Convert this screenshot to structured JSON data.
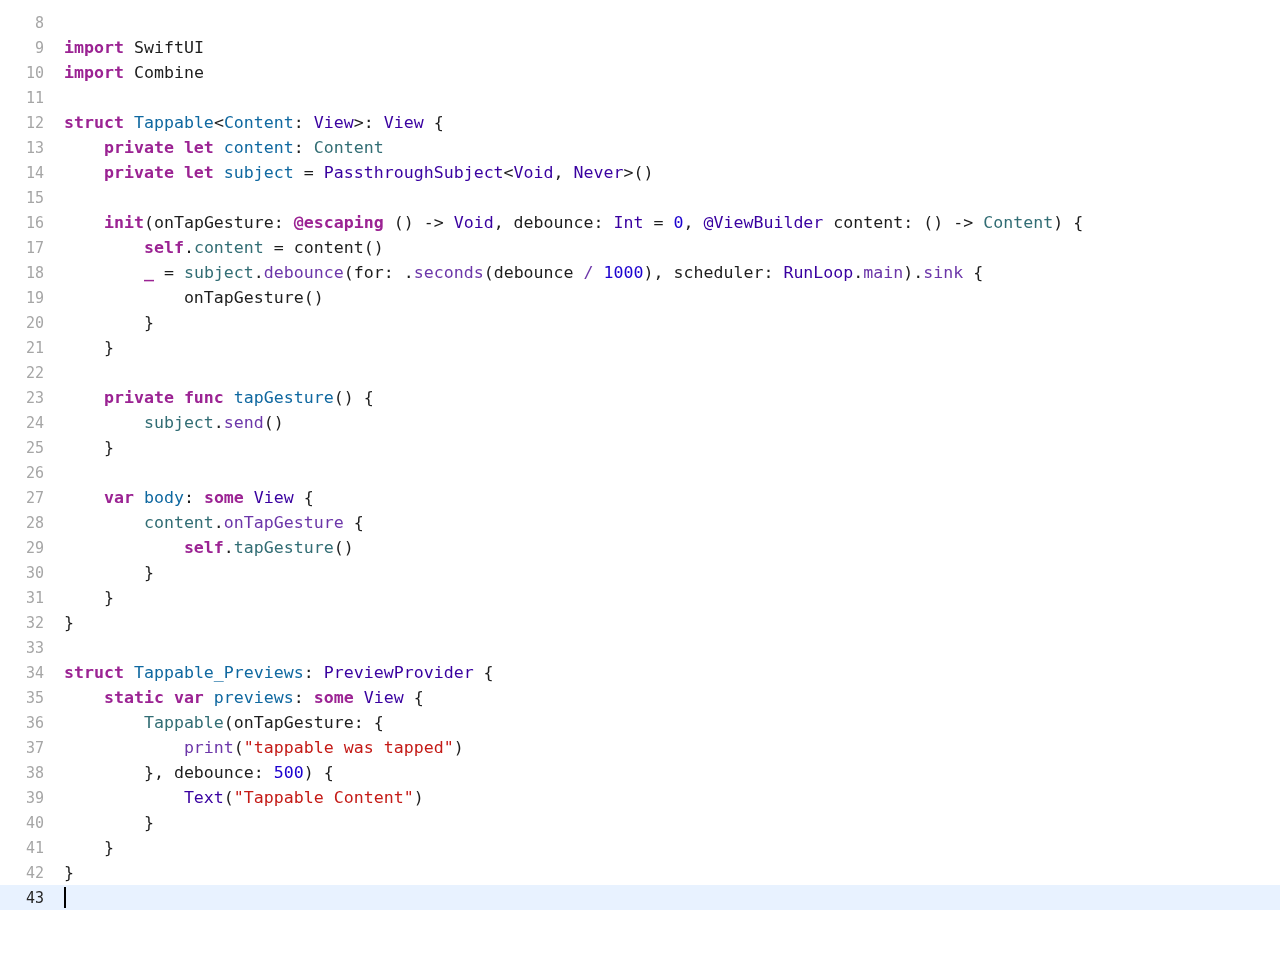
{
  "editor": {
    "lines": [
      {
        "number": "8",
        "current": false
      },
      {
        "number": "9",
        "current": false,
        "tokens": [
          {
            "kind": "keyword",
            "text": "import "
          },
          {
            "kind": "plain",
            "text": "SwiftUI"
          }
        ]
      },
      {
        "number": "10",
        "current": false,
        "tokens": [
          {
            "kind": "keyword",
            "text": "import "
          },
          {
            "kind": "plain",
            "text": "Combine"
          }
        ]
      },
      {
        "number": "11",
        "current": false
      },
      {
        "number": "12",
        "current": false,
        "tokens": [
          {
            "kind": "keyword",
            "text": "struct "
          },
          {
            "kind": "declaration",
            "text": "Tappable"
          },
          {
            "kind": "plain",
            "text": "<"
          },
          {
            "kind": "declaration",
            "text": "Content"
          },
          {
            "kind": "plain",
            "text": ": "
          },
          {
            "kind": "system_type",
            "text": "View"
          },
          {
            "kind": "plain",
            "text": ">: "
          },
          {
            "kind": "system_type",
            "text": "View"
          },
          {
            "kind": "plain",
            "text": " {"
          }
        ]
      },
      {
        "number": "13",
        "current": false,
        "tokens": [
          {
            "kind": "keyword",
            "text": "    private let "
          },
          {
            "kind": "declaration",
            "text": "content"
          },
          {
            "kind": "plain",
            "text": ": "
          },
          {
            "kind": "project",
            "text": "Content"
          }
        ]
      },
      {
        "number": "14",
        "current": false,
        "tokens": [
          {
            "kind": "keyword",
            "text": "    private let "
          },
          {
            "kind": "declaration",
            "text": "subject"
          },
          {
            "kind": "plain",
            "text": " = "
          },
          {
            "kind": "system_type",
            "text": "PassthroughSubject"
          },
          {
            "kind": "plain",
            "text": "<"
          },
          {
            "kind": "system_type",
            "text": "Void"
          },
          {
            "kind": "plain",
            "text": ", "
          },
          {
            "kind": "system_type",
            "text": "Never"
          },
          {
            "kind": "plain",
            "text": ">()"
          }
        ]
      },
      {
        "number": "15",
        "current": false
      },
      {
        "number": "16",
        "current": false,
        "tokens": [
          {
            "kind": "keyword",
            "text": "    init"
          },
          {
            "kind": "plain",
            "text": "(onTapGesture: "
          },
          {
            "kind": "keyword",
            "text": "@escaping"
          },
          {
            "kind": "plain",
            "text": " () -> "
          },
          {
            "kind": "system_type",
            "text": "Void"
          },
          {
            "kind": "plain",
            "text": ", debounce: "
          },
          {
            "kind": "system_type",
            "text": "Int"
          },
          {
            "kind": "plain",
            "text": " = "
          },
          {
            "kind": "number",
            "text": "0"
          },
          {
            "kind": "plain",
            "text": ", "
          },
          {
            "kind": "system_type",
            "text": "@ViewBuilder"
          },
          {
            "kind": "plain",
            "text": " content: () -> "
          },
          {
            "kind": "project",
            "text": "Content"
          },
          {
            "kind": "plain",
            "text": ") {"
          }
        ]
      },
      {
        "number": "17",
        "current": false,
        "tokens": [
          {
            "kind": "keyword",
            "text": "        self"
          },
          {
            "kind": "plain",
            "text": "."
          },
          {
            "kind": "project",
            "text": "content"
          },
          {
            "kind": "plain",
            "text": " = content()"
          }
        ]
      },
      {
        "number": "18",
        "current": false,
        "tokens": [
          {
            "kind": "keyword",
            "text": "        _"
          },
          {
            "kind": "plain",
            "text": " = "
          },
          {
            "kind": "project",
            "text": "subject"
          },
          {
            "kind": "plain",
            "text": "."
          },
          {
            "kind": "system_member",
            "text": "debounce"
          },
          {
            "kind": "plain",
            "text": "(for: ."
          },
          {
            "kind": "system_member",
            "text": "seconds"
          },
          {
            "kind": "plain",
            "text": "(debounce "
          },
          {
            "kind": "system_member",
            "text": "/ "
          },
          {
            "kind": "number",
            "text": "1000"
          },
          {
            "kind": "plain",
            "text": "), scheduler: "
          },
          {
            "kind": "system_type",
            "text": "RunLoop"
          },
          {
            "kind": "plain",
            "text": "."
          },
          {
            "kind": "system_member",
            "text": "main"
          },
          {
            "kind": "plain",
            "text": ")."
          },
          {
            "kind": "system_member",
            "text": "sink"
          },
          {
            "kind": "plain",
            "text": " {"
          }
        ]
      },
      {
        "number": "19",
        "current": false,
        "tokens": [
          {
            "kind": "plain",
            "text": "            onTapGesture()"
          }
        ]
      },
      {
        "number": "20",
        "current": false,
        "tokens": [
          {
            "kind": "plain",
            "text": "        }"
          }
        ]
      },
      {
        "number": "21",
        "current": false,
        "tokens": [
          {
            "kind": "plain",
            "text": "    }"
          }
        ]
      },
      {
        "number": "22",
        "current": false
      },
      {
        "number": "23",
        "current": false,
        "tokens": [
          {
            "kind": "keyword",
            "text": "    private func "
          },
          {
            "kind": "declaration",
            "text": "tapGesture"
          },
          {
            "kind": "plain",
            "text": "() {"
          }
        ]
      },
      {
        "number": "24",
        "current": false,
        "tokens": [
          {
            "kind": "project",
            "text": "        subject"
          },
          {
            "kind": "plain",
            "text": "."
          },
          {
            "kind": "system_member",
            "text": "send"
          },
          {
            "kind": "plain",
            "text": "()"
          }
        ]
      },
      {
        "number": "25",
        "current": false,
        "tokens": [
          {
            "kind": "plain",
            "text": "    }"
          }
        ]
      },
      {
        "number": "26",
        "current": false
      },
      {
        "number": "27",
        "current": false,
        "tokens": [
          {
            "kind": "keyword",
            "text": "    var "
          },
          {
            "kind": "declaration",
            "text": "body"
          },
          {
            "kind": "plain",
            "text": ": "
          },
          {
            "kind": "keyword",
            "text": "some "
          },
          {
            "kind": "system_type",
            "text": "View"
          },
          {
            "kind": "plain",
            "text": " {"
          }
        ]
      },
      {
        "number": "28",
        "current": false,
        "tokens": [
          {
            "kind": "project",
            "text": "        content"
          },
          {
            "kind": "plain",
            "text": "."
          },
          {
            "kind": "system_member",
            "text": "onTapGesture"
          },
          {
            "kind": "plain",
            "text": " {"
          }
        ]
      },
      {
        "number": "29",
        "current": false,
        "tokens": [
          {
            "kind": "keyword",
            "text": "            self"
          },
          {
            "kind": "plain",
            "text": "."
          },
          {
            "kind": "project",
            "text": "tapGesture"
          },
          {
            "kind": "plain",
            "text": "()"
          }
        ]
      },
      {
        "number": "30",
        "current": false,
        "tokens": [
          {
            "kind": "plain",
            "text": "        }"
          }
        ]
      },
      {
        "number": "31",
        "current": false,
        "tokens": [
          {
            "kind": "plain",
            "text": "    }"
          }
        ]
      },
      {
        "number": "32",
        "current": false,
        "tokens": [
          {
            "kind": "plain",
            "text": "}"
          }
        ]
      },
      {
        "number": "33",
        "current": false
      },
      {
        "number": "34",
        "current": false,
        "tokens": [
          {
            "kind": "keyword",
            "text": "struct "
          },
          {
            "kind": "declaration",
            "text": "Tappable_Previews"
          },
          {
            "kind": "plain",
            "text": ": "
          },
          {
            "kind": "system_type",
            "text": "PreviewProvider"
          },
          {
            "kind": "plain",
            "text": " {"
          }
        ]
      },
      {
        "number": "35",
        "current": false,
        "tokens": [
          {
            "kind": "keyword",
            "text": "    static var "
          },
          {
            "kind": "declaration",
            "text": "previews"
          },
          {
            "kind": "plain",
            "text": ": "
          },
          {
            "kind": "keyword",
            "text": "some "
          },
          {
            "kind": "system_type",
            "text": "View"
          },
          {
            "kind": "plain",
            "text": " {"
          }
        ]
      },
      {
        "number": "36",
        "current": false,
        "tokens": [
          {
            "kind": "project",
            "text": "        Tappable"
          },
          {
            "kind": "plain",
            "text": "(onTapGesture: {"
          }
        ]
      },
      {
        "number": "37",
        "current": false,
        "tokens": [
          {
            "kind": "system_member",
            "text": "            print"
          },
          {
            "kind": "plain",
            "text": "("
          },
          {
            "kind": "string",
            "text": "\"tappable was tapped\""
          },
          {
            "kind": "plain",
            "text": ")"
          }
        ]
      },
      {
        "number": "38",
        "current": false,
        "tokens": [
          {
            "kind": "plain",
            "text": "        }, debounce: "
          },
          {
            "kind": "number",
            "text": "500"
          },
          {
            "kind": "plain",
            "text": ") {"
          }
        ]
      },
      {
        "number": "39",
        "current": false,
        "tokens": [
          {
            "kind": "system_type",
            "text": "            Text"
          },
          {
            "kind": "plain",
            "text": "("
          },
          {
            "kind": "string",
            "text": "\"Tappable Content\""
          },
          {
            "kind": "plain",
            "text": ")"
          }
        ]
      },
      {
        "number": "40",
        "current": false,
        "tokens": [
          {
            "kind": "plain",
            "text": "        }"
          }
        ]
      },
      {
        "number": "41",
        "current": false,
        "tokens": [
          {
            "kind": "plain",
            "text": "    }"
          }
        ]
      },
      {
        "number": "42",
        "current": false,
        "tokens": [
          {
            "kind": "plain",
            "text": "}"
          }
        ]
      },
      {
        "number": "43",
        "current": true
      }
    ]
  }
}
